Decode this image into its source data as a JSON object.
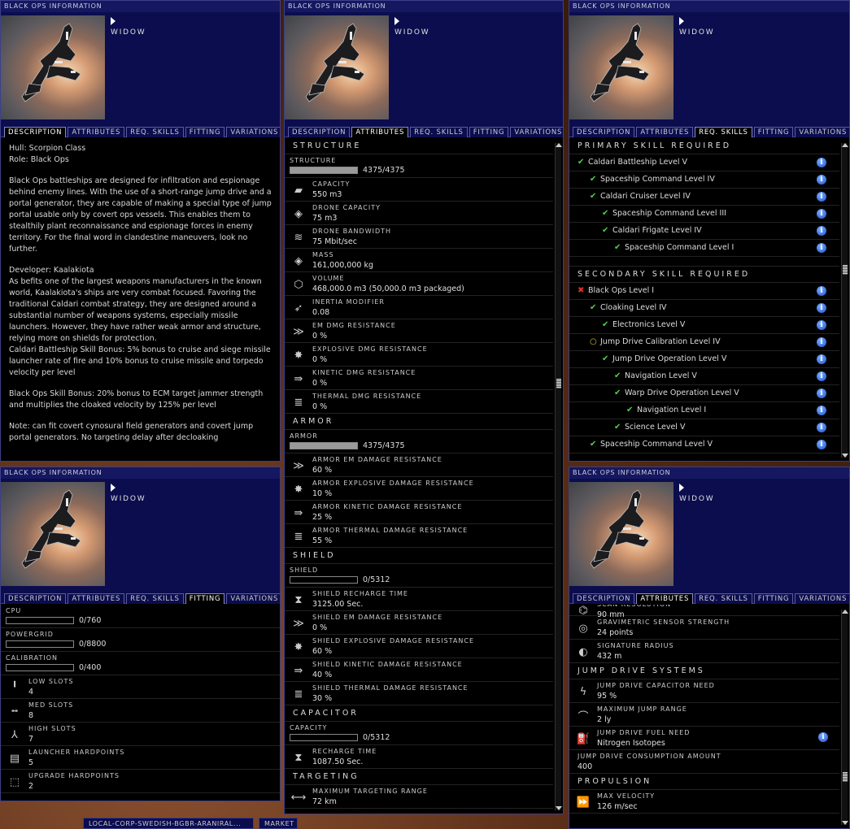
{
  "window_title": "BLACK OPS INFORMATION",
  "ship_name": "WIDOW",
  "tabs": [
    "DESCRIPTION",
    "ATTRIBUTES",
    "REQ. SKILLS",
    "FITTING",
    "VARIATIONS"
  ],
  "description": {
    "lines": [
      "Hull: Scorpion Class",
      "Role: Black Ops"
    ],
    "p1": "Black Ops battleships are designed for infiltration and espionage behind enemy lines. With the use of a short-range jump drive and a portal generator, they are capable of making a special type of jump portal usable only by covert ops vessels. This enables them to stealthily plant reconnaissance and espionage forces in enemy territory. For the final word in clandestine maneuvers, look no further.",
    "developer": "Developer: Kaalakiota",
    "p2": "As befits one of the largest weapons manufacturers in the known world, Kaalakiota's ships are very combat focused. Favoring the traditional Caldari combat strategy, they are designed around a substantial number of weapons systems, especially missile launchers. However, they have rather weak armor and structure, relying more on shields for protection.",
    "p3": "Caldari Battleship Skill Bonus: 5% bonus to cruise and siege missile launcher rate of fire and 10% bonus to cruise missile and torpedo velocity per level",
    "p4": "Black Ops Skill Bonus: 20% bonus to ECM target jammer strength and multiplies the cloaked velocity by 125% per level",
    "p5": "Note: can fit covert cynosural field generators and covert jump portal generators. No targeting delay after decloaking"
  },
  "attributes": {
    "structure_header": "STRUCTURE",
    "structure_bar": {
      "label": "STRUCTURE",
      "value": "4375/4375",
      "fill": 1.0
    },
    "structure_rows": [
      {
        "icon": "capacity-icon",
        "glyph": "▰",
        "name": "CAPACITY",
        "value": "550 m3"
      },
      {
        "icon": "drone-capacity-icon",
        "glyph": "◈",
        "name": "DRONE CAPACITY",
        "value": "75 m3"
      },
      {
        "icon": "drone-bandwidth-icon",
        "glyph": "≋",
        "name": "DRONE BANDWIDTH",
        "value": "75 Mbit/sec"
      },
      {
        "icon": "mass-icon",
        "glyph": "◈",
        "name": "MASS",
        "value": "161,000,000 kg"
      },
      {
        "icon": "volume-icon",
        "glyph": "⬡",
        "name": "VOLUME",
        "value": "468,000.0 m3 (50,000.0 m3 packaged)"
      },
      {
        "icon": "inertia-icon",
        "glyph": "➶",
        "name": "INERTIA MODIFIER",
        "value": "0.08"
      },
      {
        "icon": "em-resist-icon",
        "glyph": "≫",
        "name": "EM DMG RESISTANCE",
        "value": "0 %"
      },
      {
        "icon": "explosive-resist-icon",
        "glyph": "✸",
        "name": "EXPLOSIVE DMG RESISTANCE",
        "value": "0 %"
      },
      {
        "icon": "kinetic-resist-icon",
        "glyph": "⇛",
        "name": "KINETIC DMG RESISTANCE",
        "value": "0 %"
      },
      {
        "icon": "thermal-resist-icon",
        "glyph": "≣",
        "name": "THERMAL DMG RESISTANCE",
        "value": "0 %"
      }
    ],
    "armor_header": "ARMOR",
    "armor_bar": {
      "label": "ARMOR",
      "value": "4375/4375",
      "fill": 1.0
    },
    "armor_rows": [
      {
        "icon": "em-resist-icon",
        "glyph": "≫",
        "name": "ARMOR EM DAMAGE RESISTANCE",
        "value": "60 %"
      },
      {
        "icon": "explosive-resist-icon",
        "glyph": "✸",
        "name": "ARMOR EXPLOSIVE DAMAGE RESISTANCE",
        "value": "10 %"
      },
      {
        "icon": "kinetic-resist-icon",
        "glyph": "⇛",
        "name": "ARMOR KINETIC DAMAGE RESISTANCE",
        "value": "25 %"
      },
      {
        "icon": "thermal-resist-icon",
        "glyph": "≣",
        "name": "ARMOR THERMAL DAMAGE RESISTANCE",
        "value": "55 %"
      }
    ],
    "shield_header": "SHIELD",
    "shield_bar": {
      "label": "SHIELD",
      "value": "0/5312",
      "fill": 0.0
    },
    "shield_rows": [
      {
        "icon": "hourglass-icon",
        "glyph": "⧗",
        "name": "SHIELD RECHARGE TIME",
        "value": "3125.00 Sec."
      },
      {
        "icon": "em-resist-icon",
        "glyph": "≫",
        "name": "SHIELD EM DAMAGE RESISTANCE",
        "value": "0 %"
      },
      {
        "icon": "explosive-resist-icon",
        "glyph": "✸",
        "name": "SHIELD EXPLOSIVE DAMAGE RESISTANCE",
        "value": "60 %"
      },
      {
        "icon": "kinetic-resist-icon",
        "glyph": "⇛",
        "name": "SHIELD KINETIC DAMAGE RESISTANCE",
        "value": "40 %"
      },
      {
        "icon": "thermal-resist-icon",
        "glyph": "≣",
        "name": "SHIELD THERMAL DAMAGE RESISTANCE",
        "value": "30 %"
      }
    ],
    "capacitor_header": "CAPACITOR",
    "capacitor_bar": {
      "label": "CAPACITY",
      "value": "0/5312",
      "fill": 0.0
    },
    "capacitor_rows": [
      {
        "icon": "hourglass-icon",
        "glyph": "⧗",
        "name": "RECHARGE TIME",
        "value": "1087.50 Sec."
      }
    ],
    "targeting_header": "TARGETING",
    "targeting_rows": [
      {
        "icon": "targeting-range-icon",
        "glyph": "⟷",
        "name": "MAXIMUM TARGETING RANGE",
        "value": "72 km"
      }
    ]
  },
  "skills": {
    "primary_header": "PRIMARY SKILL REQUIRED",
    "primary": [
      {
        "status": "ok",
        "name": "Caldari Battleship Level V",
        "depth": 0
      },
      {
        "status": "ok",
        "name": "Spaceship Command Level IV",
        "depth": 1
      },
      {
        "status": "ok",
        "name": "Caldari Cruiser Level IV",
        "depth": 1
      },
      {
        "status": "ok",
        "name": "Spaceship Command Level III",
        "depth": 2
      },
      {
        "status": "ok",
        "name": "Caldari Frigate Level IV",
        "depth": 2
      },
      {
        "status": "ok",
        "name": "Spaceship Command Level I",
        "depth": 3
      }
    ],
    "secondary_header": "SECONDARY SKILL REQUIRED",
    "secondary": [
      {
        "status": "no",
        "name": "Black Ops Level I",
        "depth": 0
      },
      {
        "status": "ok",
        "name": "Cloaking Level IV",
        "depth": 1
      },
      {
        "status": "ok",
        "name": "Electronics Level V",
        "depth": 2
      },
      {
        "status": "pend",
        "name": "Jump Drive Calibration Level IV",
        "depth": 1
      },
      {
        "status": "ok",
        "name": "Jump Drive Operation Level V",
        "depth": 2
      },
      {
        "status": "ok",
        "name": "Navigation Level V",
        "depth": 3
      },
      {
        "status": "ok",
        "name": "Warp Drive Operation Level V",
        "depth": 3
      },
      {
        "status": "ok",
        "name": "Navigation Level I",
        "depth": 4
      },
      {
        "status": "ok",
        "name": "Science Level V",
        "depth": 3
      },
      {
        "status": "ok",
        "name": "Spaceship Command Level V",
        "depth": 1
      }
    ]
  },
  "fitting": {
    "cpu": {
      "label": "CPU",
      "value": "0/760",
      "fill": 0.0
    },
    "powergrid": {
      "label": "POWERGRID",
      "value": "0/8800",
      "fill": 0.0
    },
    "calibration": {
      "label": "CALIBRATION",
      "value": "0/400",
      "fill": 0.0
    },
    "rows": [
      {
        "icon": "low-slot-icon",
        "glyph": "╹",
        "name": "LOW SLOTS",
        "value": "4"
      },
      {
        "icon": "med-slot-icon",
        "glyph": "╍",
        "name": "MED SLOTS",
        "value": "8"
      },
      {
        "icon": "high-slot-icon",
        "glyph": "⅄",
        "name": "HIGH SLOTS",
        "value": "7"
      },
      {
        "icon": "launcher-icon",
        "glyph": "▤",
        "name": "LAUNCHER HARDPOINTS",
        "value": "5"
      },
      {
        "icon": "upgrade-icon",
        "glyph": "⬚",
        "name": "UPGRADE HARDPOINTS",
        "value": "2"
      }
    ]
  },
  "attributes2": {
    "partial_row": {
      "name": "SCAN RESOLUTION",
      "value": "90 mm"
    },
    "rows_top": [
      {
        "icon": "gravimetric-icon",
        "glyph": "◎",
        "name": "GRAVIMETRIC SENSOR STRENGTH",
        "value": "24 points"
      },
      {
        "icon": "signature-icon",
        "glyph": "◐",
        "name": "SIGNATURE RADIUS",
        "value": "432 m"
      }
    ],
    "jump_header": "JUMP DRIVE SYSTEMS",
    "jump_rows": [
      {
        "icon": "capacitor-need-icon",
        "glyph": "ϟ",
        "name": "JUMP DRIVE CAPACITOR NEED",
        "value": "95 %"
      },
      {
        "icon": "jump-range-icon",
        "glyph": "⌒",
        "name": "MAXIMUM JUMP RANGE",
        "value": "2 ly"
      },
      {
        "icon": "fuel-icon",
        "glyph": "⛽",
        "name": "JUMP DRIVE FUEL NEED",
        "value": "Nitrogen Isotopes",
        "info": true
      }
    ],
    "consumption": {
      "name": "JUMP DRIVE CONSUMPTION AMOUNT",
      "value": "400"
    },
    "propulsion_header": "PROPULSION",
    "propulsion_rows": [
      {
        "icon": "velocity-icon",
        "glyph": "⏩",
        "name": "MAX VELOCITY",
        "value": "126 m/sec"
      }
    ]
  },
  "taskbar": [
    "LOCAL-CORP-SWEDISH-BGBR-ARANIRAL...",
    "MARKET"
  ]
}
